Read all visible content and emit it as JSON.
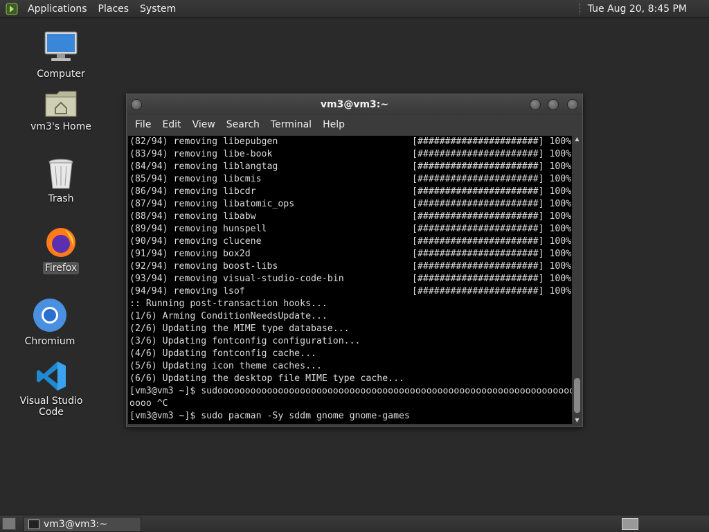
{
  "top_panel": {
    "menus": [
      "Applications",
      "Places",
      "System"
    ],
    "clock": "Tue Aug 20,  8:45 PM"
  },
  "desktop_icons": [
    {
      "label": "Computer",
      "icon": "computer-icon"
    },
    {
      "label": "vm3's Home",
      "icon": "home-folder-icon"
    },
    {
      "label": "Trash",
      "icon": "trash-icon"
    },
    {
      "label": "Firefox",
      "icon": "firefox-icon"
    },
    {
      "label": "Chromium",
      "icon": "chromium-icon"
    },
    {
      "label": "Visual Studio Code",
      "icon": "vscode-icon"
    }
  ],
  "terminal": {
    "title": "vm3@vm3:~",
    "menu": [
      "File",
      "Edit",
      "View",
      "Search",
      "Terminal",
      "Help"
    ],
    "progress_lines": [
      {
        "text": "(82/94) removing libepubgen",
        "bar": "[######################] 100%"
      },
      {
        "text": "(83/94) removing libe-book",
        "bar": "[######################] 100%"
      },
      {
        "text": "(84/94) removing liblangtag",
        "bar": "[######################] 100%"
      },
      {
        "text": "(85/94) removing libcmis",
        "bar": "[######################] 100%"
      },
      {
        "text": "(86/94) removing libcdr",
        "bar": "[######################] 100%"
      },
      {
        "text": "(87/94) removing libatomic_ops",
        "bar": "[######################] 100%"
      },
      {
        "text": "(88/94) removing libabw",
        "bar": "[######################] 100%"
      },
      {
        "text": "(89/94) removing hunspell",
        "bar": "[######################] 100%"
      },
      {
        "text": "(90/94) removing clucene",
        "bar": "[######################] 100%"
      },
      {
        "text": "(91/94) removing box2d",
        "bar": "[######################] 100%"
      },
      {
        "text": "(92/94) removing boost-libs",
        "bar": "[######################] 100%"
      },
      {
        "text": "(93/94) removing visual-studio-code-bin",
        "bar": "[######################] 100%"
      },
      {
        "text": "(94/94) removing lsof",
        "bar": "[######################] 100%"
      }
    ],
    "lines": [
      ":: Running post-transaction hooks...",
      "(1/6) Arming ConditionNeedsUpdate...",
      "(2/6) Updating the MIME type database...",
      "(3/6) Updating fontconfig configuration...",
      "(4/6) Updating fontconfig cache...",
      "(5/6) Updating icon theme caches...",
      "(6/6) Updating the desktop file MIME type cache...",
      "[vm3@vm3 ~]$ sudoooooooooooooooooooooooooooooooooooooooooooooooooooooooooooooooooo",
      "oooo ^C",
      "[vm3@vm3 ~]$ sudo pacman -Sy sddm gnome gnome-games"
    ]
  },
  "taskbar": {
    "task_label": "vm3@vm3:~"
  }
}
